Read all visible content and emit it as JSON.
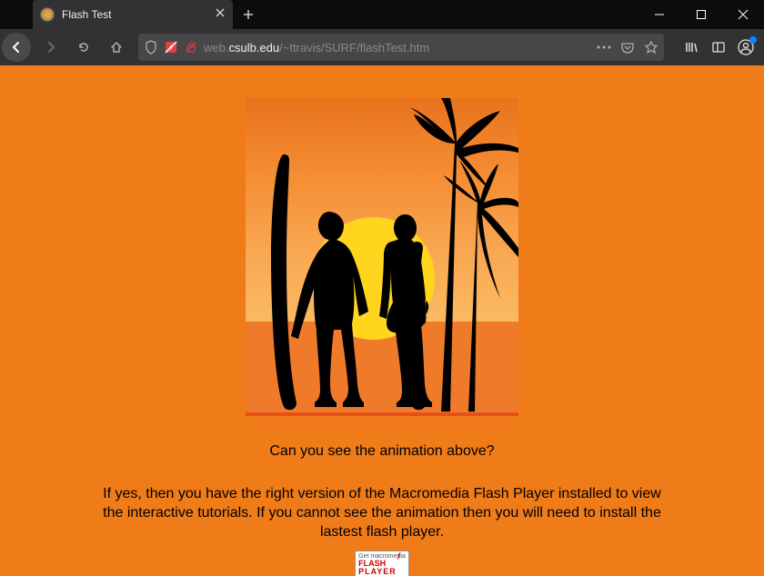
{
  "window": {
    "tab_title": "Flash Test"
  },
  "url": {
    "prefix": "web.",
    "host": "csulb.edu",
    "path": "/~ttravis/SURF/flashTest.htm"
  },
  "page": {
    "question": "Can you see the animation above?",
    "explain": "If yes, then you have the right version of the Macromedia Flash Player installed to view the interactive tutorials. If you cannot see the animation then you will need to install the lastest flash player.",
    "flash_btn_line1": "Get macromedia",
    "flash_btn_line2": "FLASH",
    "flash_btn_line3": "PLAYER"
  }
}
